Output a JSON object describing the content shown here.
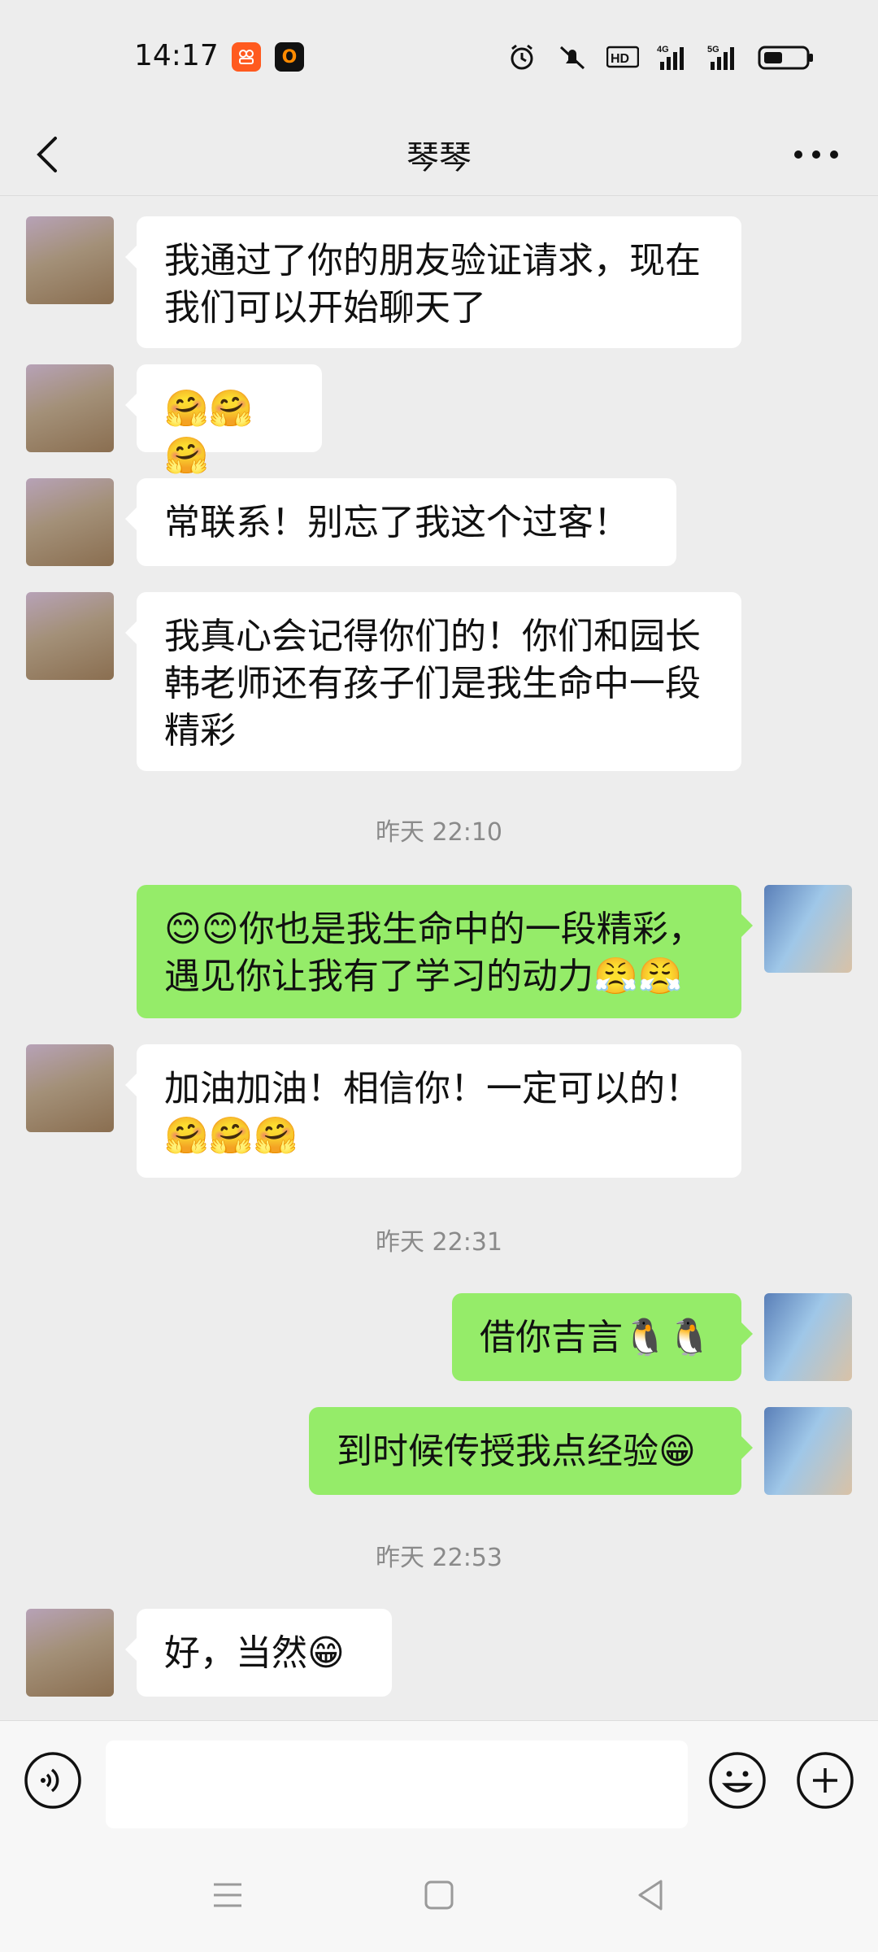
{
  "status_bar": {
    "time": "14:17",
    "app_badges": [
      "O"
    ],
    "icons": [
      "alarm-icon",
      "mute-icon",
      "hd-icon",
      "signal-4g-icon",
      "signal-5g-icon",
      "battery-icon"
    ]
  },
  "nav": {
    "title": "琴琴",
    "back_icon": "chevron-left-icon",
    "more_icon": "more-horizontal-icon"
  },
  "messages": [
    {
      "type": "in",
      "text": "我通过了你的朋友验证请求，现在我们可以开始聊天了"
    },
    {
      "type": "in",
      "text": "🤗🤗🤗"
    },
    {
      "type": "in",
      "text": "常联系！别忘了我这个过客！"
    },
    {
      "type": "in",
      "text": "我真心会记得你们的！你们和园长韩老师还有孩子们是我生命中一段精彩"
    },
    {
      "type": "time",
      "text": "昨天 22:10"
    },
    {
      "type": "out",
      "text": "😊😊你也是我生命中的一段精彩，遇见你让我有了学习的动力😤😤"
    },
    {
      "type": "in",
      "text": "加油加油！相信你！一定可以的！🤗🤗🤗"
    },
    {
      "type": "time",
      "text": "昨天 22:31"
    },
    {
      "type": "out",
      "text": "借你吉言🐧🐧"
    },
    {
      "type": "out",
      "text": "到时候传授我点经验😁"
    },
    {
      "type": "time",
      "text": "昨天 22:53"
    },
    {
      "type": "in",
      "text": "好，当然😁"
    }
  ],
  "input": {
    "placeholder": "",
    "voice_icon": "voice-icon",
    "emoji_icon": "emoji-icon",
    "plus_icon": "plus-icon"
  },
  "system_nav": {
    "icons": [
      "menu-icon",
      "home-icon",
      "back-icon"
    ]
  },
  "colors": {
    "background": "#ededed",
    "bubble_in": "#ffffff",
    "bubble_out": "#95ec69",
    "timestamp": "#8a8a8a"
  }
}
